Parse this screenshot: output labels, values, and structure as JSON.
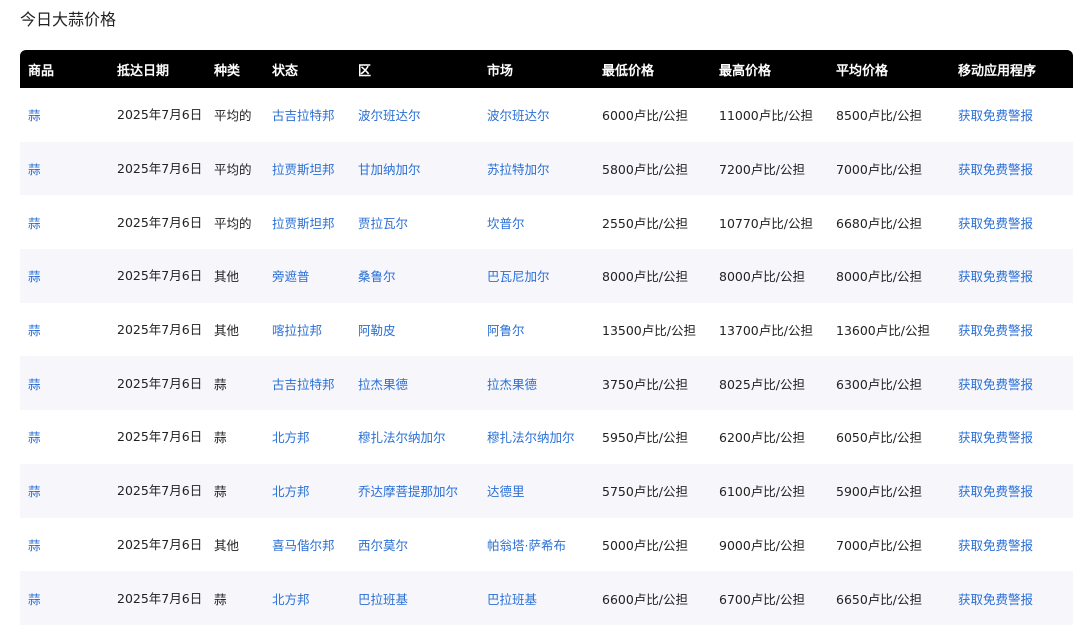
{
  "page": {
    "title": "今日大蒜价格"
  },
  "table": {
    "headers": [
      "商品",
      "抵达日期",
      "种类",
      "状态",
      "区",
      "市场",
      "最低价格",
      "最高价格",
      "平均价格",
      "移动应用程序"
    ],
    "rows": [
      {
        "commodity": "蒜",
        "date": "2025年7月6日",
        "variety": "平均的",
        "state": "古吉拉特邦",
        "district": "波尔班达尔",
        "market": "波尔班达尔",
        "min_price": "6000卢比/公担",
        "max_price": "11000卢比/公担",
        "avg_price": "8500卢比/公担",
        "app": "获取免费警报"
      },
      {
        "commodity": "蒜",
        "date": "2025年7月6日",
        "variety": "平均的",
        "state": "拉贾斯坦邦",
        "district": "甘加纳加尔",
        "market": "苏拉特加尔",
        "min_price": "5800卢比/公担",
        "max_price": "7200卢比/公担",
        "avg_price": "7000卢比/公担",
        "app": "获取免费警报"
      },
      {
        "commodity": "蒜",
        "date": "2025年7月6日",
        "variety": "平均的",
        "state": "拉贾斯坦邦",
        "district": "贾拉瓦尔",
        "market": "坎普尔",
        "min_price": "2550卢比/公担",
        "max_price": "10770卢比/公担",
        "avg_price": "6680卢比/公担",
        "app": "获取免费警报"
      },
      {
        "commodity": "蒜",
        "date": "2025年7月6日",
        "variety": "其他",
        "state": "旁遮普",
        "district": "桑鲁尔",
        "market": "巴瓦尼加尔",
        "min_price": "8000卢比/公担",
        "max_price": "8000卢比/公担",
        "avg_price": "8000卢比/公担",
        "app": "获取免费警报"
      },
      {
        "commodity": "蒜",
        "date": "2025年7月6日",
        "variety": "其他",
        "state": "喀拉拉邦",
        "district": "阿勒皮",
        "market": "阿鲁尔",
        "min_price": "13500卢比/公担",
        "max_price": "13700卢比/公担",
        "avg_price": "13600卢比/公担",
        "app": "获取免费警报"
      },
      {
        "commodity": "蒜",
        "date": "2025年7月6日",
        "variety": "蒜",
        "state": "古吉拉特邦",
        "district": "拉杰果德",
        "market": "拉杰果德",
        "min_price": "3750卢比/公担",
        "max_price": "8025卢比/公担",
        "avg_price": "6300卢比/公担",
        "app": "获取免费警报"
      },
      {
        "commodity": "蒜",
        "date": "2025年7月6日",
        "variety": "蒜",
        "state": "北方邦",
        "district": "穆扎法尔纳加尔",
        "market": "穆扎法尔纳加尔",
        "min_price": "5950卢比/公担",
        "max_price": "6200卢比/公担",
        "avg_price": "6050卢比/公担",
        "app": "获取免费警报"
      },
      {
        "commodity": "蒜",
        "date": "2025年7月6日",
        "variety": "蒜",
        "state": "北方邦",
        "district": "乔达摩菩提那加尔",
        "market": "达德里",
        "min_price": "5750卢比/公担",
        "max_price": "6100卢比/公担",
        "avg_price": "5900卢比/公担",
        "app": "获取免费警报"
      },
      {
        "commodity": "蒜",
        "date": "2025年7月6日",
        "variety": "其他",
        "state": "喜马偕尔邦",
        "district": "西尔莫尔",
        "market": "帕翁塔·萨希布",
        "min_price": "5000卢比/公担",
        "max_price": "9000卢比/公担",
        "avg_price": "7000卢比/公担",
        "app": "获取免费警报"
      },
      {
        "commodity": "蒜",
        "date": "2025年7月6日",
        "variety": "蒜",
        "state": "北方邦",
        "district": "巴拉班基",
        "market": "巴拉班基",
        "min_price": "6600卢比/公担",
        "max_price": "6700卢比/公担",
        "avg_price": "6650卢比/公担",
        "app": "获取免费警报"
      }
    ]
  },
  "colors": {
    "header_bg": "#000000",
    "header_text": "#ffffff",
    "link": "#2a6fd6",
    "row_alt": "#f7f7fb"
  }
}
